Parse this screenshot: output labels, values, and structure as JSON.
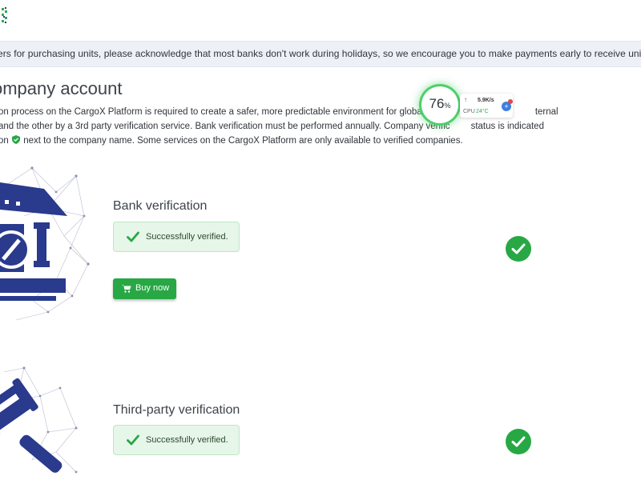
{
  "notice": {
    "text": "ers for purchasing units, please acknowledge that most banks don't work during holidays, so we encourage you to make payments early to receive units on time. Cred"
  },
  "page": {
    "title": "ompany account",
    "description_lines": [
      "on process on the CargoX Platform is required to create a safer, more predictable environment for global tra",
      "and the other by a 3rd party verification service. Bank verification must be performed annually. Company verific",
      "on",
      "next to the company name. Some services on the CargoX Platform are only available to verified companies."
    ],
    "description_line1_tail": "ternal",
    "description_line2_tail": "status is indicated"
  },
  "cpu_widget": {
    "percent": "76",
    "percent_sign": "%",
    "arrow": "↑",
    "speed": "5.9K/s",
    "label": "CPU",
    "temperature": "24°C",
    "badge": "+"
  },
  "sections": {
    "bank": {
      "title": "Bank verification",
      "status_text": "Successfully verified.",
      "buy_label": "Buy now"
    },
    "third_party": {
      "title": "Third-party verification",
      "status_text": "Successfully verified."
    }
  },
  "colors": {
    "success_green": "#28a745",
    "illustration_navy": "#2a3a8c",
    "banner_bg": "#eef0f7"
  },
  "icons": {
    "logo": "cargox-logo-fragment",
    "bank": "bank-building-illustration",
    "gavel": "gavel-illustration",
    "verified": "check-icon",
    "cart": "cart-icon",
    "shield": "shield-check-icon"
  }
}
